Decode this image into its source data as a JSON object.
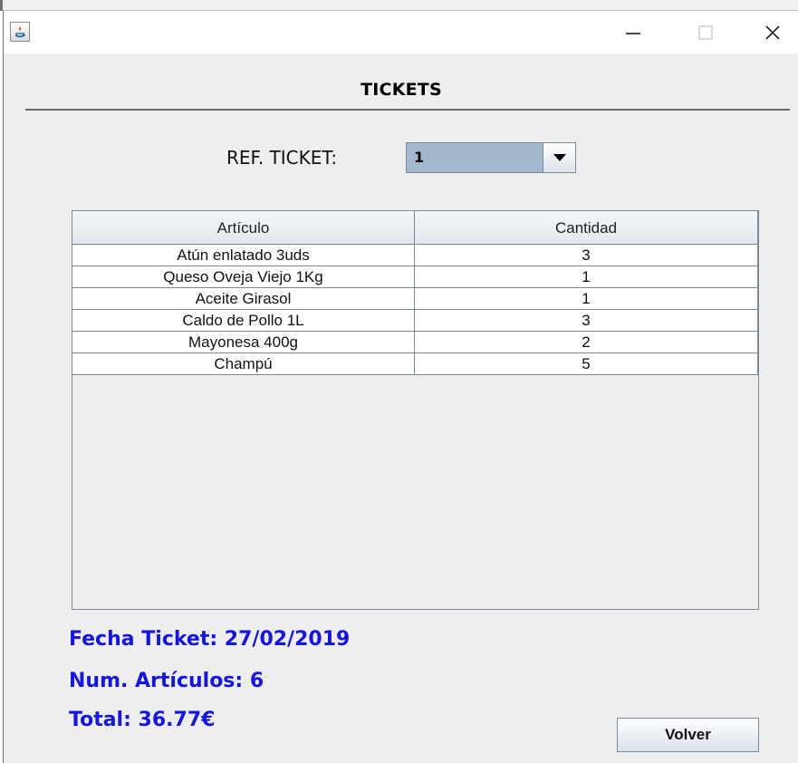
{
  "window": {
    "icon": "java-icon",
    "controls": {
      "minimize": "minimize-icon",
      "maximize": "maximize-icon",
      "close": "close-icon"
    }
  },
  "header": {
    "title": "TICKETS"
  },
  "ref_ticket": {
    "label": "REF. TICKET:",
    "selected": "1",
    "arrow": "chevron-down-icon"
  },
  "table": {
    "columns": [
      "Artículo",
      "Cantidad"
    ],
    "rows": [
      [
        "Atún enlatado 3uds",
        "3"
      ],
      [
        "Queso Oveja Viejo 1Kg",
        "1"
      ],
      [
        "Aceite Girasol",
        "1"
      ],
      [
        "Caldo de Pollo 1L",
        "3"
      ],
      [
        "Mayonesa 400g",
        "2"
      ],
      [
        "Champú",
        "5"
      ]
    ]
  },
  "info": {
    "fecha": "Fecha Ticket: 27/02/2019",
    "num_articulos": "Num. Artículos: 6",
    "total": "Total: 36.77€"
  },
  "buttons": {
    "volver": "Volver"
  },
  "colors": {
    "info_text": "#1414e6",
    "combo_bg": "#a3b8cc",
    "window_bg": "#eeeeee"
  }
}
